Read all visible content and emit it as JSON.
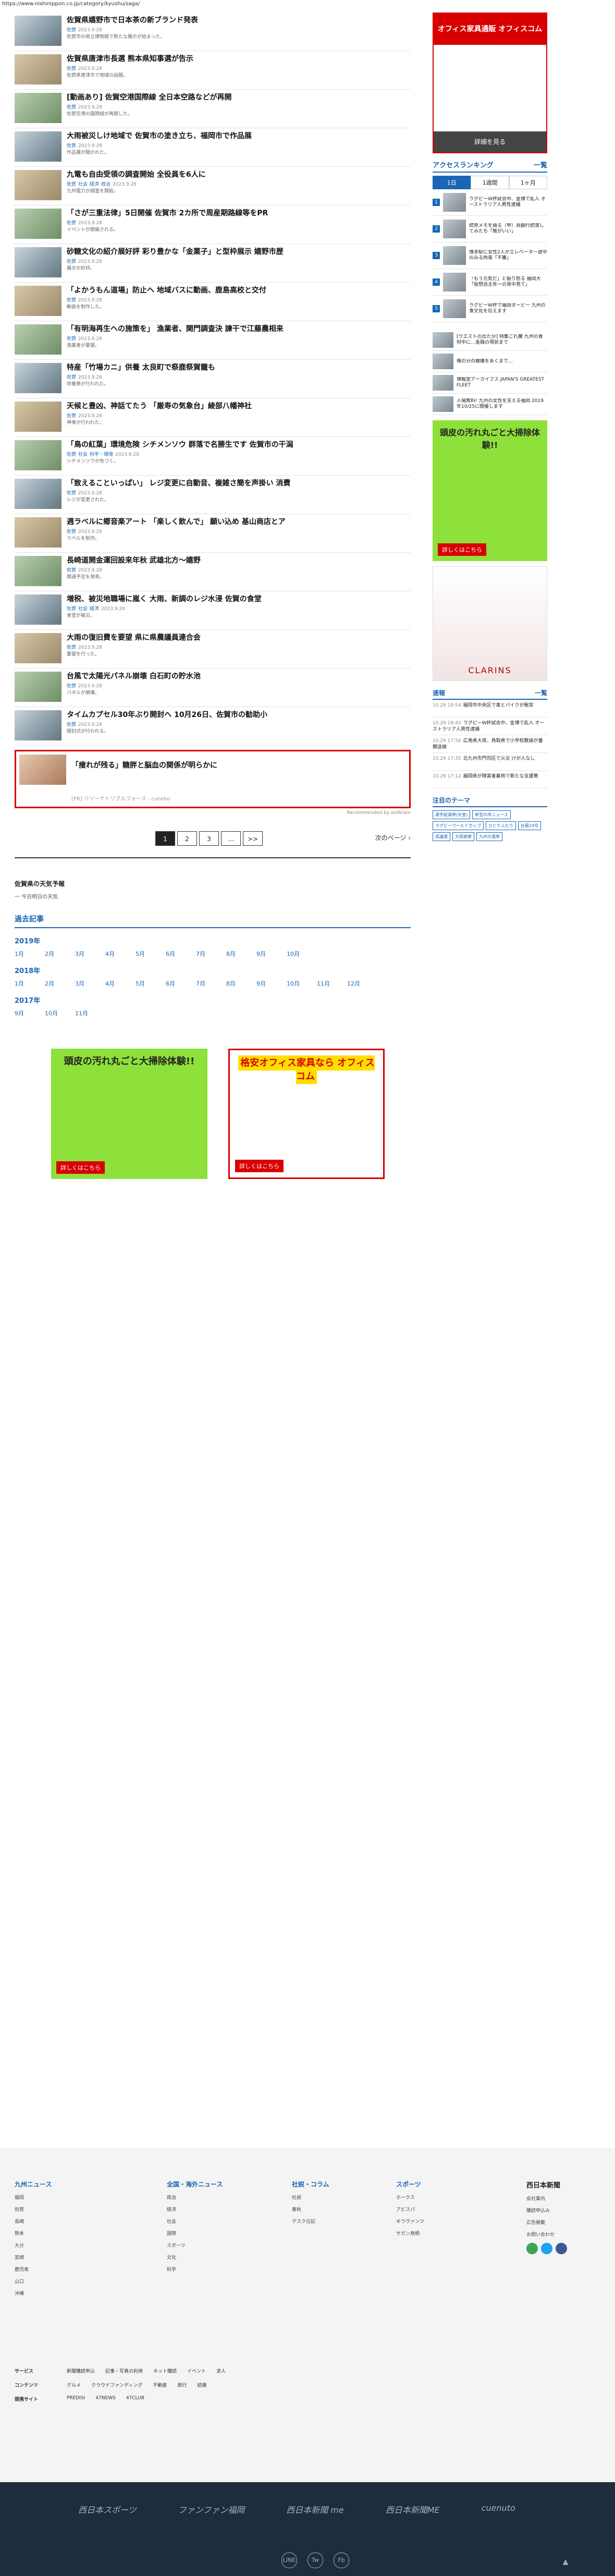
{
  "url": "https://www.nishinippon.co.jp/category/kyushu/saga/",
  "articles": [
    {
      "title": "佐賀県嬉野市で日本茶の新ブランド発表",
      "tags": [
        "佐賀"
      ],
      "date": "2023.9.28",
      "excerpt": "佐賀市の県立博物館で新たな展示が始まった。"
    },
    {
      "title": "佐賀県唐津市長選 熊本県知事選が告示",
      "tags": [
        "佐賀"
      ],
      "date": "2023.9.28",
      "excerpt": "佐賀県唐津市で地域の話題。"
    },
    {
      "title": "[動画あり] 佐賀空港国際線 全日本空路などが再開",
      "tags": [
        "佐賀"
      ],
      "date": "2023.9.28",
      "excerpt": "佐賀空港の国際線が再開した。"
    },
    {
      "title": "大雨被災しけ地域で 佐賀市の塗き立ち、福岡市で作品展",
      "tags": [
        "佐賀"
      ],
      "date": "2023.9.28",
      "excerpt": "作品展が開かれた。"
    },
    {
      "title": "九電も自由受領の調査開始 全役員を6人に",
      "tags": [
        "佐賀",
        "社会",
        "経済",
        "政治"
      ],
      "date": "2023.9.28",
      "excerpt": "九州電力が調査を開始。"
    },
    {
      "title": "「さが三重法律」5日開催 佐賀市 2カ所で周産期路線等をPR",
      "tags": [
        "佐賀"
      ],
      "date": "2023.9.28",
      "excerpt": "イベントが開催される。"
    },
    {
      "title": "砂糖文化の紹介展好評 彩り豊かな「金菓子」と型枠展示 嬉野市歴",
      "tags": [
        "佐賀"
      ],
      "date": "2023.9.28",
      "excerpt": "展示が好評。"
    },
    {
      "title": "「よかうもん道場」防止へ 地域バスに動画、鹿島高校と交付",
      "tags": [
        "佐賀"
      ],
      "date": "2023.9.28",
      "excerpt": "動画を制作した。"
    },
    {
      "title": "「有明海再生への施策を」 漁業者、関門調査決 諫干で江藤農相来",
      "tags": [
        "佐賀"
      ],
      "date": "2023.9.28",
      "excerpt": "漁業者が要望。"
    },
    {
      "title": "特産「竹場カニ」供養 太良町で祭鹿祭賀籠も",
      "tags": [
        "佐賀"
      ],
      "date": "2023.9.28",
      "excerpt": "供養祭が行われた。"
    },
    {
      "title": "天候と豊凶、神話てたう 「厳寿の気象台」綾部八幡神社",
      "tags": [
        "佐賀"
      ],
      "date": "2023.9.28",
      "excerpt": "神事が行われた。"
    },
    {
      "title": "「鳥の紅葉」環境危険 シチメンソウ 群落で名勝生です 佐賀市の干潟",
      "tags": [
        "佐賀",
        "社会",
        "科学・環境"
      ],
      "date": "2023.9.28",
      "excerpt": "シチメンソウが色づく。"
    },
    {
      "title": "「致えることいっぱい」 レジ変更に自動音、複雑さ簡を声掛い 消費",
      "tags": [
        "佐賀"
      ],
      "date": "2023.9.28",
      "excerpt": "レジが変更された。"
    },
    {
      "title": "週ラベルに郷音楽アート 「楽しく飲んで」 願い込め 基山商店とア",
      "tags": [
        "佐賀"
      ],
      "date": "2023.9.28",
      "excerpt": "ラベルを制作。"
    },
    {
      "title": "長崎道開金運回設来年秋 武雄北方～嬉野",
      "tags": [
        "佐賀"
      ],
      "date": "2023.9.28",
      "excerpt": "開通予定を発表。"
    },
    {
      "title": "増税、被災地職場に嵐く 大雨、新調のレジ水浸 佐賀の食堂",
      "tags": [
        "佐賀",
        "社会",
        "経済"
      ],
      "date": "2023.9.28",
      "excerpt": "食堂が被災。"
    },
    {
      "title": "大雨の復旧費を要望 県に県農議員連合会",
      "tags": [
        "佐賀"
      ],
      "date": "2023.9.28",
      "excerpt": "要望を行った。"
    },
    {
      "title": "台風で太陽光パネル崩壊 白石町の貯水池",
      "tags": [
        "佐賀"
      ],
      "date": "2023.9.28",
      "excerpt": "パネルが崩壊。"
    },
    {
      "title": "タイムカプセル30年ぶり開封へ 10月26日、佐賀市の勧助小",
      "tags": [
        "佐賀"
      ],
      "date": "2023.9.28",
      "excerpt": "開封式が行われる。"
    }
  ],
  "promo": {
    "title": "「痩れが残る」糖胖と脳血の関係が明らかに",
    "source": "[PR] リゾーナトリプルフォース - cuneko"
  },
  "powered_by": "Recommended by outbrain",
  "pagination": {
    "pages": [
      "1",
      "2",
      "3",
      "…",
      ">>"
    ],
    "next_label": "次のページ"
  },
  "weather_head": "佐賀県の天気予報",
  "weather_link": "一 今日明日の天気",
  "archive": {
    "head": "過去記事",
    "years": [
      {
        "year": "2019年",
        "months": [
          "1月",
          "2月",
          "3月",
          "4月",
          "5月",
          "6月",
          "7月",
          "8月",
          "9月",
          "10月"
        ]
      },
      {
        "year": "2018年",
        "months": [
          "1月",
          "2月",
          "3月",
          "4月",
          "5月",
          "6月",
          "7月",
          "8月",
          "9月",
          "10月",
          "11月",
          "12月"
        ]
      },
      {
        "year": "2017年",
        "months": [
          "9月",
          "10月",
          "11月"
        ]
      }
    ]
  },
  "bottom_ads": [
    {
      "head": "頭皮の汚れ丸ごと大掃除体験!!",
      "badge": "詳しくはこちら"
    },
    {
      "head": "格安オフィス家具なら オフィスコム",
      "badge": "詳しくはこちら"
    }
  ],
  "sidebar": {
    "top_ad": {
      "banner": "オフィス家具通販 オフィスコム",
      "bottom": "詳細を見る"
    },
    "ranking_head": "アクセスランキング",
    "ranking_more": "一覧",
    "ranking_tabs": [
      "1日",
      "1週間",
      "1ヶ月"
    ],
    "ranking": [
      "ラグビーW杯試合中、金博で乱入 オーストラリア人男性逮捕",
      "読売メモを語る（甲）頁翻行読落してみたち「無がいい」",
      "博多駅に女性2人がエレベーター途中のみる拘束「不審」",
      "「もう元気だ」と振り怒る 福岡大「仮想自主年一の背中見て」",
      "ラグビーW杯で福岡ダービー 九州の食文化を伝えます"
    ],
    "pr_items": [
      "[ウエストの出た分] 特集ごれ魔 九州の食材中に…金融の現状まで",
      "俺の分の腰痛をあくまで…",
      "博報堂アーカイブス JAPAN'S GREATEST FLEET",
      "入場無料! 九州の女性を支える福岡 2019年10/25に開催します"
    ],
    "green_ad": {
      "head": "頭皮の汚れ丸ごと大掃除体験!!",
      "badge": "詳しくはこちら"
    },
    "clarins": {
      "brand": "CLARINS"
    },
    "news_head": "速報",
    "news_more": "一覧",
    "news": [
      {
        "date": "10.29 18:54",
        "text": "福岡市中央区で車とバイクが衝突"
      },
      {
        "date": "10.29 18:40",
        "text": "ラグビーW杯試合中、金博で乱入 オーストラリア人男性逮捕"
      },
      {
        "date": "10.29 17:50",
        "text": "広島県大将、鳥取県で小学校教諭が書類送検"
      },
      {
        "date": "10.29 17:35",
        "text": "北九州市門司区で火災 けが人なし"
      },
      {
        "date": "10.29 17:12",
        "text": "福岡県が障害者雇用で新たな支援策"
      }
    ],
    "theme_head": "注目のテーマ",
    "themes": [
      "選手総選挙(天皇)",
      "新型の市ニュース",
      "ラグビーワールドカップ",
      "ひとりふたり",
      "台風19号",
      "県議選",
      "大雨被害",
      "九州の選挙"
    ]
  },
  "footer": {
    "cols": [
      {
        "head": "九州ニュース",
        "items": [
          "福岡",
          "佐賀",
          "長崎",
          "熊本",
          "大分",
          "宮崎",
          "鹿児島",
          "山口",
          "沖縄"
        ]
      },
      {
        "head": "全国・海外ニュース",
        "items": [
          "政治",
          "経済",
          "社会",
          "国際",
          "スポーツ",
          "文化",
          "科学"
        ]
      },
      {
        "head": "社説・コラム",
        "items": [
          "社説",
          "春秋",
          "デスク日記"
        ]
      },
      {
        "head": "スポーツ",
        "items": [
          "ホークス",
          "アビスパ",
          "ギラヴァンツ",
          "サガン鳥栖"
        ]
      }
    ],
    "brand": "西日本新聞",
    "brand_items": [
      "会社案内",
      "購読申込み",
      "広告掲載",
      "お問い合わせ"
    ],
    "links": [
      {
        "label": "サービス",
        "items": [
          "新聞購読申込",
          "記事・写真の利用",
          "ネット購読",
          "イベント",
          "求人"
        ]
      },
      {
        "label": "コンテンツ",
        "items": [
          "グルメ",
          "クラウドファンディング",
          "不動産",
          "旅行",
          "結婚"
        ]
      },
      {
        "label": "提携サイト",
        "items": [
          "PREDISI",
          "47NEWS",
          "47CLUB"
        ]
      }
    ],
    "logos": [
      "西日本スポーツ",
      "ファンファン福岡",
      "西日本新聞 me",
      "西日本新聞ME",
      "cuenuto"
    ],
    "sns": [
      "LINE",
      "Tw",
      "Fb"
    ],
    "top": "▲"
  }
}
